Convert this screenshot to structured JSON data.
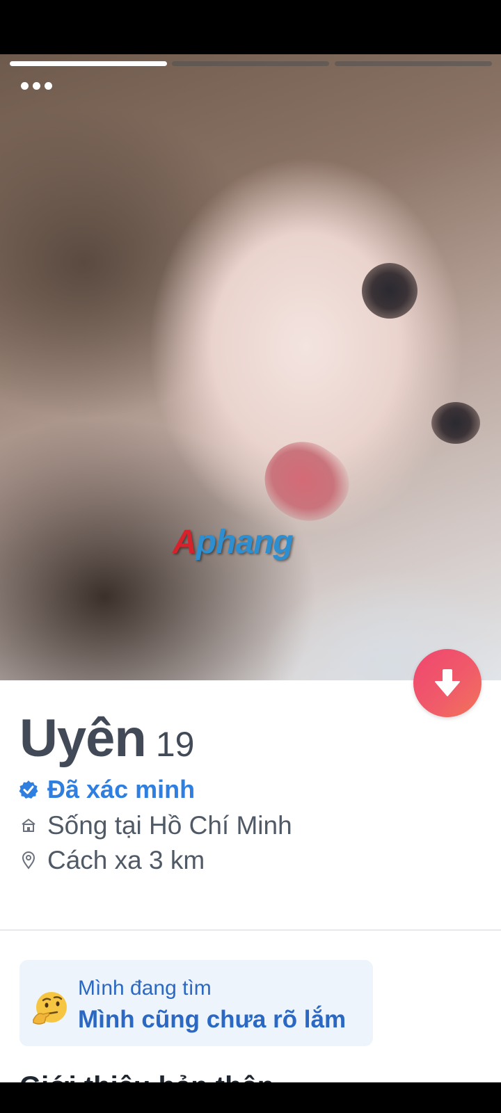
{
  "photo": {
    "progress_segments": 3,
    "active_segment": 1,
    "watermark": "Aphang"
  },
  "profile": {
    "name": "Uyên",
    "age": "19",
    "verified": "Đã xác minh",
    "lives_in": "Sống tại Hồ Chí Minh",
    "distance": "Cách xa 3 km"
  },
  "looking_for": {
    "label": "Mình đang tìm",
    "value": "Mình cũng chưa rõ lắm"
  },
  "about": {
    "title": "Giới thiệu bản thân"
  },
  "colors": {
    "accent_blue": "#2f7fe0",
    "action_gradient_start": "#f0466f",
    "action_gradient_end": "#f2745a"
  },
  "icons": {
    "verified": "verified-badge-icon",
    "home": "home-icon",
    "location": "location-pin-icon",
    "more": "more-dots-icon",
    "down": "arrow-down-icon"
  }
}
